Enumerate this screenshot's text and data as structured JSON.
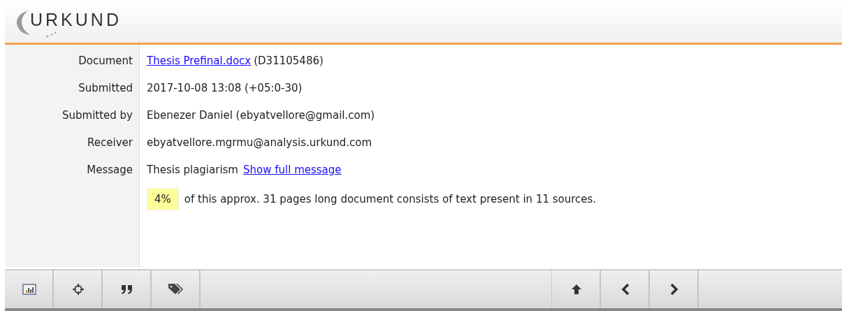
{
  "logo": {
    "text": "URKUND"
  },
  "details": [
    {
      "label": "Document",
      "kind": "link_text",
      "link": "Thesis Prefinal.docx",
      "text": "(D31105486)"
    },
    {
      "label": "Submitted",
      "kind": "text",
      "text": "2017-10-08 13:08 (+05:0-30)"
    },
    {
      "label": "Submitted by",
      "kind": "text",
      "text": "Ebenezer Daniel (ebyatvellore@gmail.com)"
    },
    {
      "label": "Receiver",
      "kind": "text",
      "text": "ebyatvellore.mgrmu@analysis.urkund.com"
    },
    {
      "label": "Message",
      "kind": "text_link",
      "text": "Thesis plagiarism",
      "link": "Show full message"
    }
  ],
  "summary": {
    "percent": "4%",
    "text": "of this approx. 31 pages long document consists of text present in 11 sources."
  }
}
